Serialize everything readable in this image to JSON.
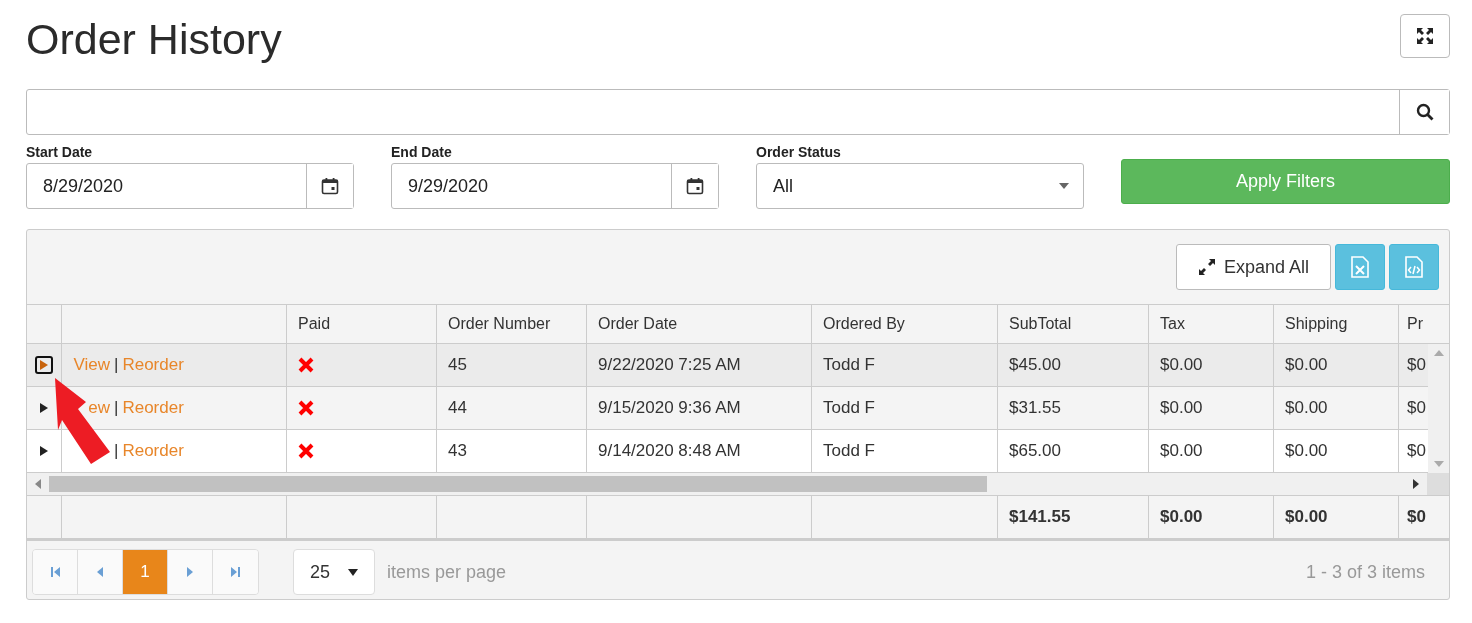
{
  "title": "Order History",
  "filters": [
    {
      "kind": "date",
      "label": "Start Date",
      "value": "8/29/2020"
    },
    {
      "kind": "date",
      "label": "End Date",
      "value": "9/29/2020"
    },
    {
      "kind": "select",
      "label": "Order Status",
      "value": "All"
    }
  ],
  "apply_button": "Apply Filters",
  "grid": {
    "expand_all": "Expand All",
    "columns": [
      "Paid",
      "Order Number",
      "Order Date",
      "Ordered By",
      "SubTotal",
      "Tax",
      "Shipping",
      "Pr"
    ],
    "rows": [
      {
        "selected": true,
        "view": "View",
        "separator": "|",
        "reorder": "Reorder",
        "paid": false,
        "order_number": "45",
        "order_date": "9/22/2020 7:25 AM",
        "ordered_by": "Todd F",
        "subtotal": "$45.00",
        "tax": "$0.00",
        "shipping": "$0.00",
        "column_9": "$0"
      },
      {
        "selected": false,
        "view": "ew",
        "separator": "|",
        "reorder": "Reorder",
        "paid": false,
        "order_number": "44",
        "order_date": "9/15/2020 9:36 AM",
        "ordered_by": "Todd F",
        "subtotal": "$31.55",
        "tax": "$0.00",
        "shipping": "$0.00",
        "column_9": "$0"
      },
      {
        "selected": false,
        "separator": "|",
        "reorder": "Reorder",
        "paid": false,
        "order_number": "43",
        "order_date": "9/14/2020 8:48 AM",
        "ordered_by": "Todd F",
        "subtotal": "$65.00",
        "tax": "$0.00",
        "shipping": "$0.00",
        "column_9": "$0"
      }
    ],
    "totals": {
      "subtotal": "$141.55",
      "tax": "$0.00",
      "shipping": "$0.00",
      "column_9": "$0"
    },
    "pager": {
      "pages": [
        {
          "label": "1",
          "selected": true
        }
      ],
      "page_size": "25",
      "page_size_label": "items per page",
      "summary": "1 - 3 of 3 items"
    }
  }
}
